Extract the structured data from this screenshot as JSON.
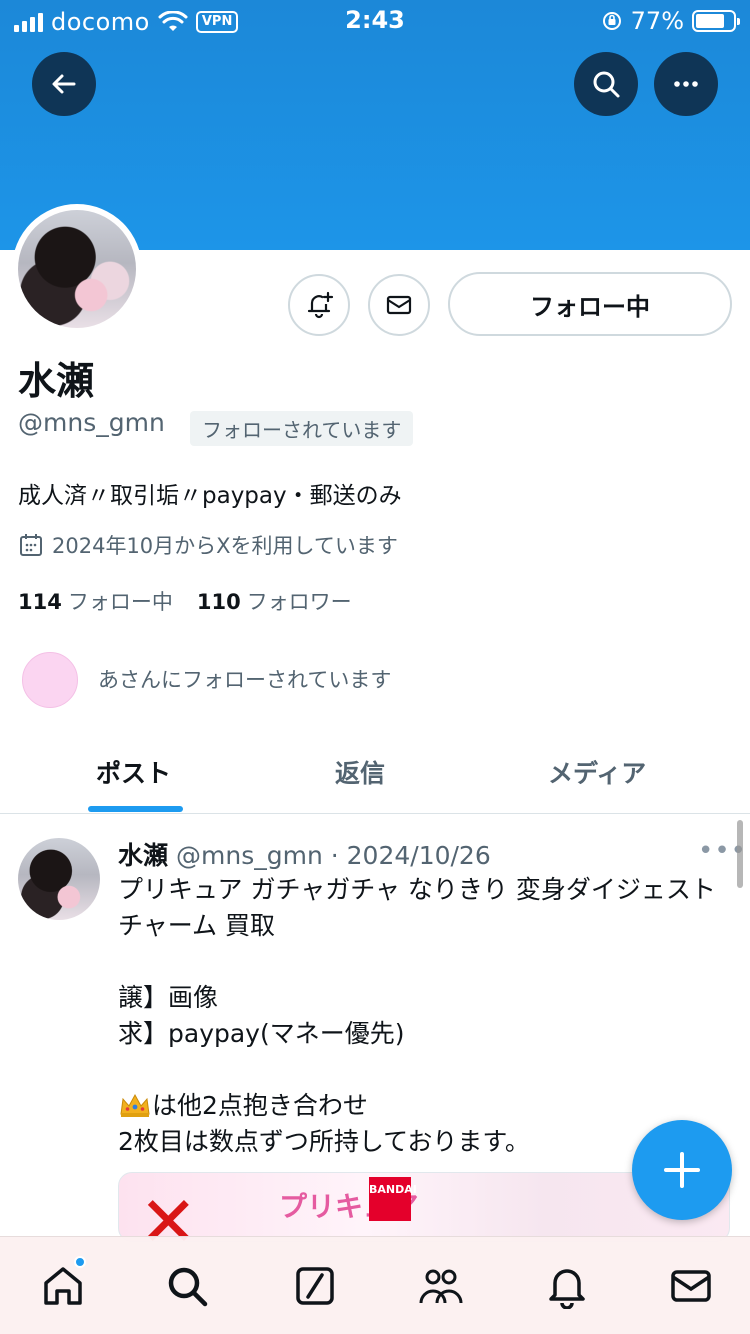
{
  "status_bar": {
    "carrier": "docomo",
    "vpn": "VPN",
    "time": "2:43",
    "battery": "77%",
    "battery_level": 0.77
  },
  "header": {
    "back_icon": "arrow-left-icon",
    "search_icon": "search-icon",
    "more_icon": "more-icon",
    "banner_color": "#1d95e8"
  },
  "profile": {
    "display_name": "水瀬",
    "handle": "@mns_gmn",
    "follows_you": "フォローされています",
    "following_button": "フォロー中",
    "bio": "成人済〃取引垢〃paypay・郵送のみ",
    "joined": "2024年10月からXを利用しています",
    "following_count": "114",
    "following_label": "フォロー中",
    "followers_count": "110",
    "followers_label": "フォロワー",
    "mutual_text": "あさんにフォローされています"
  },
  "tabs": [
    {
      "label": "ポスト",
      "active": true
    },
    {
      "label": "返信",
      "active": false
    },
    {
      "label": "メディア",
      "active": false
    }
  ],
  "post": {
    "name": "水瀬",
    "meta": "@mns_gmn · 2024/10/26",
    "more": "•••",
    "line1": "プリキュア ガチャガチャ なりきり 変身ダイジェストチャーム 買取",
    "line2": "譲】画像\n求】paypay(マネー優先)",
    "line3": "は他2点抱き合わせ\n2枚目は数点ずつ所持しております。",
    "media_title": "プリキュア",
    "media_brand": "BANDAI"
  },
  "accent_color": "#1d9bf0",
  "bottom_nav": [
    "home-icon",
    "search-icon",
    "grok-icon",
    "communities-icon",
    "notifications-icon",
    "messages-icon"
  ]
}
